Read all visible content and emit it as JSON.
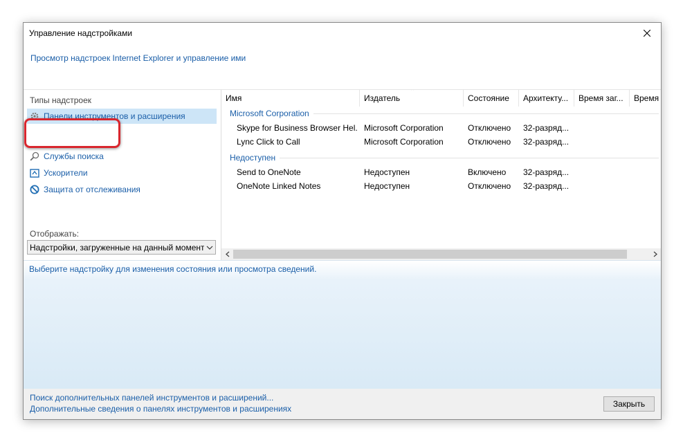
{
  "window": {
    "title": "Управление надстройками",
    "header_link": "Просмотр надстроек Internet Explorer и управление ими"
  },
  "left": {
    "types_label": "Типы надстроек",
    "items": [
      {
        "label": "Панели инструментов и расширения",
        "icon": "gear-icon",
        "selected": true
      },
      {
        "label": "Службы поиска",
        "icon": "search-icon",
        "selected": false
      },
      {
        "label": "Ускорители",
        "icon": "accelerator-icon",
        "selected": false
      },
      {
        "label": "Защита от отслеживания",
        "icon": "no-entry-icon",
        "selected": false
      }
    ],
    "show_label": "Отображать:",
    "dropdown_value": "Надстройки, загруженные на данный момент"
  },
  "list": {
    "columns": [
      "Имя",
      "Издатель",
      "Состояние",
      "Архитекту...",
      "Время заг...",
      "Время"
    ],
    "groups": [
      {
        "name": "Microsoft Corporation",
        "rows": [
          [
            "Skype for Business Browser Hel...",
            "Microsoft Corporation",
            "Отключено",
            "32-разряд..."
          ],
          [
            "Lync Click to Call",
            "Microsoft Corporation",
            "Отключено",
            "32-разряд..."
          ]
        ]
      },
      {
        "name": "Недоступен",
        "rows": [
          [
            "Send to OneNote",
            "Недоступен",
            "Включено",
            "32-разряд..."
          ],
          [
            "OneNote Linked Notes",
            "Недоступен",
            "Отключено",
            "32-разряд..."
          ]
        ]
      }
    ]
  },
  "details": {
    "text": "Выберите надстройку для изменения состояния или просмотра сведений."
  },
  "footer": {
    "link1": "Поиск дополнительных панелей инструментов и расширений...",
    "link2": "Дополнительные сведения о панелях инструментов и расширениях",
    "close_label": "Закрыть"
  },
  "colors": {
    "link": "#1a5ea8",
    "selection": "#cde5f7",
    "highlight": "#d9262e"
  }
}
